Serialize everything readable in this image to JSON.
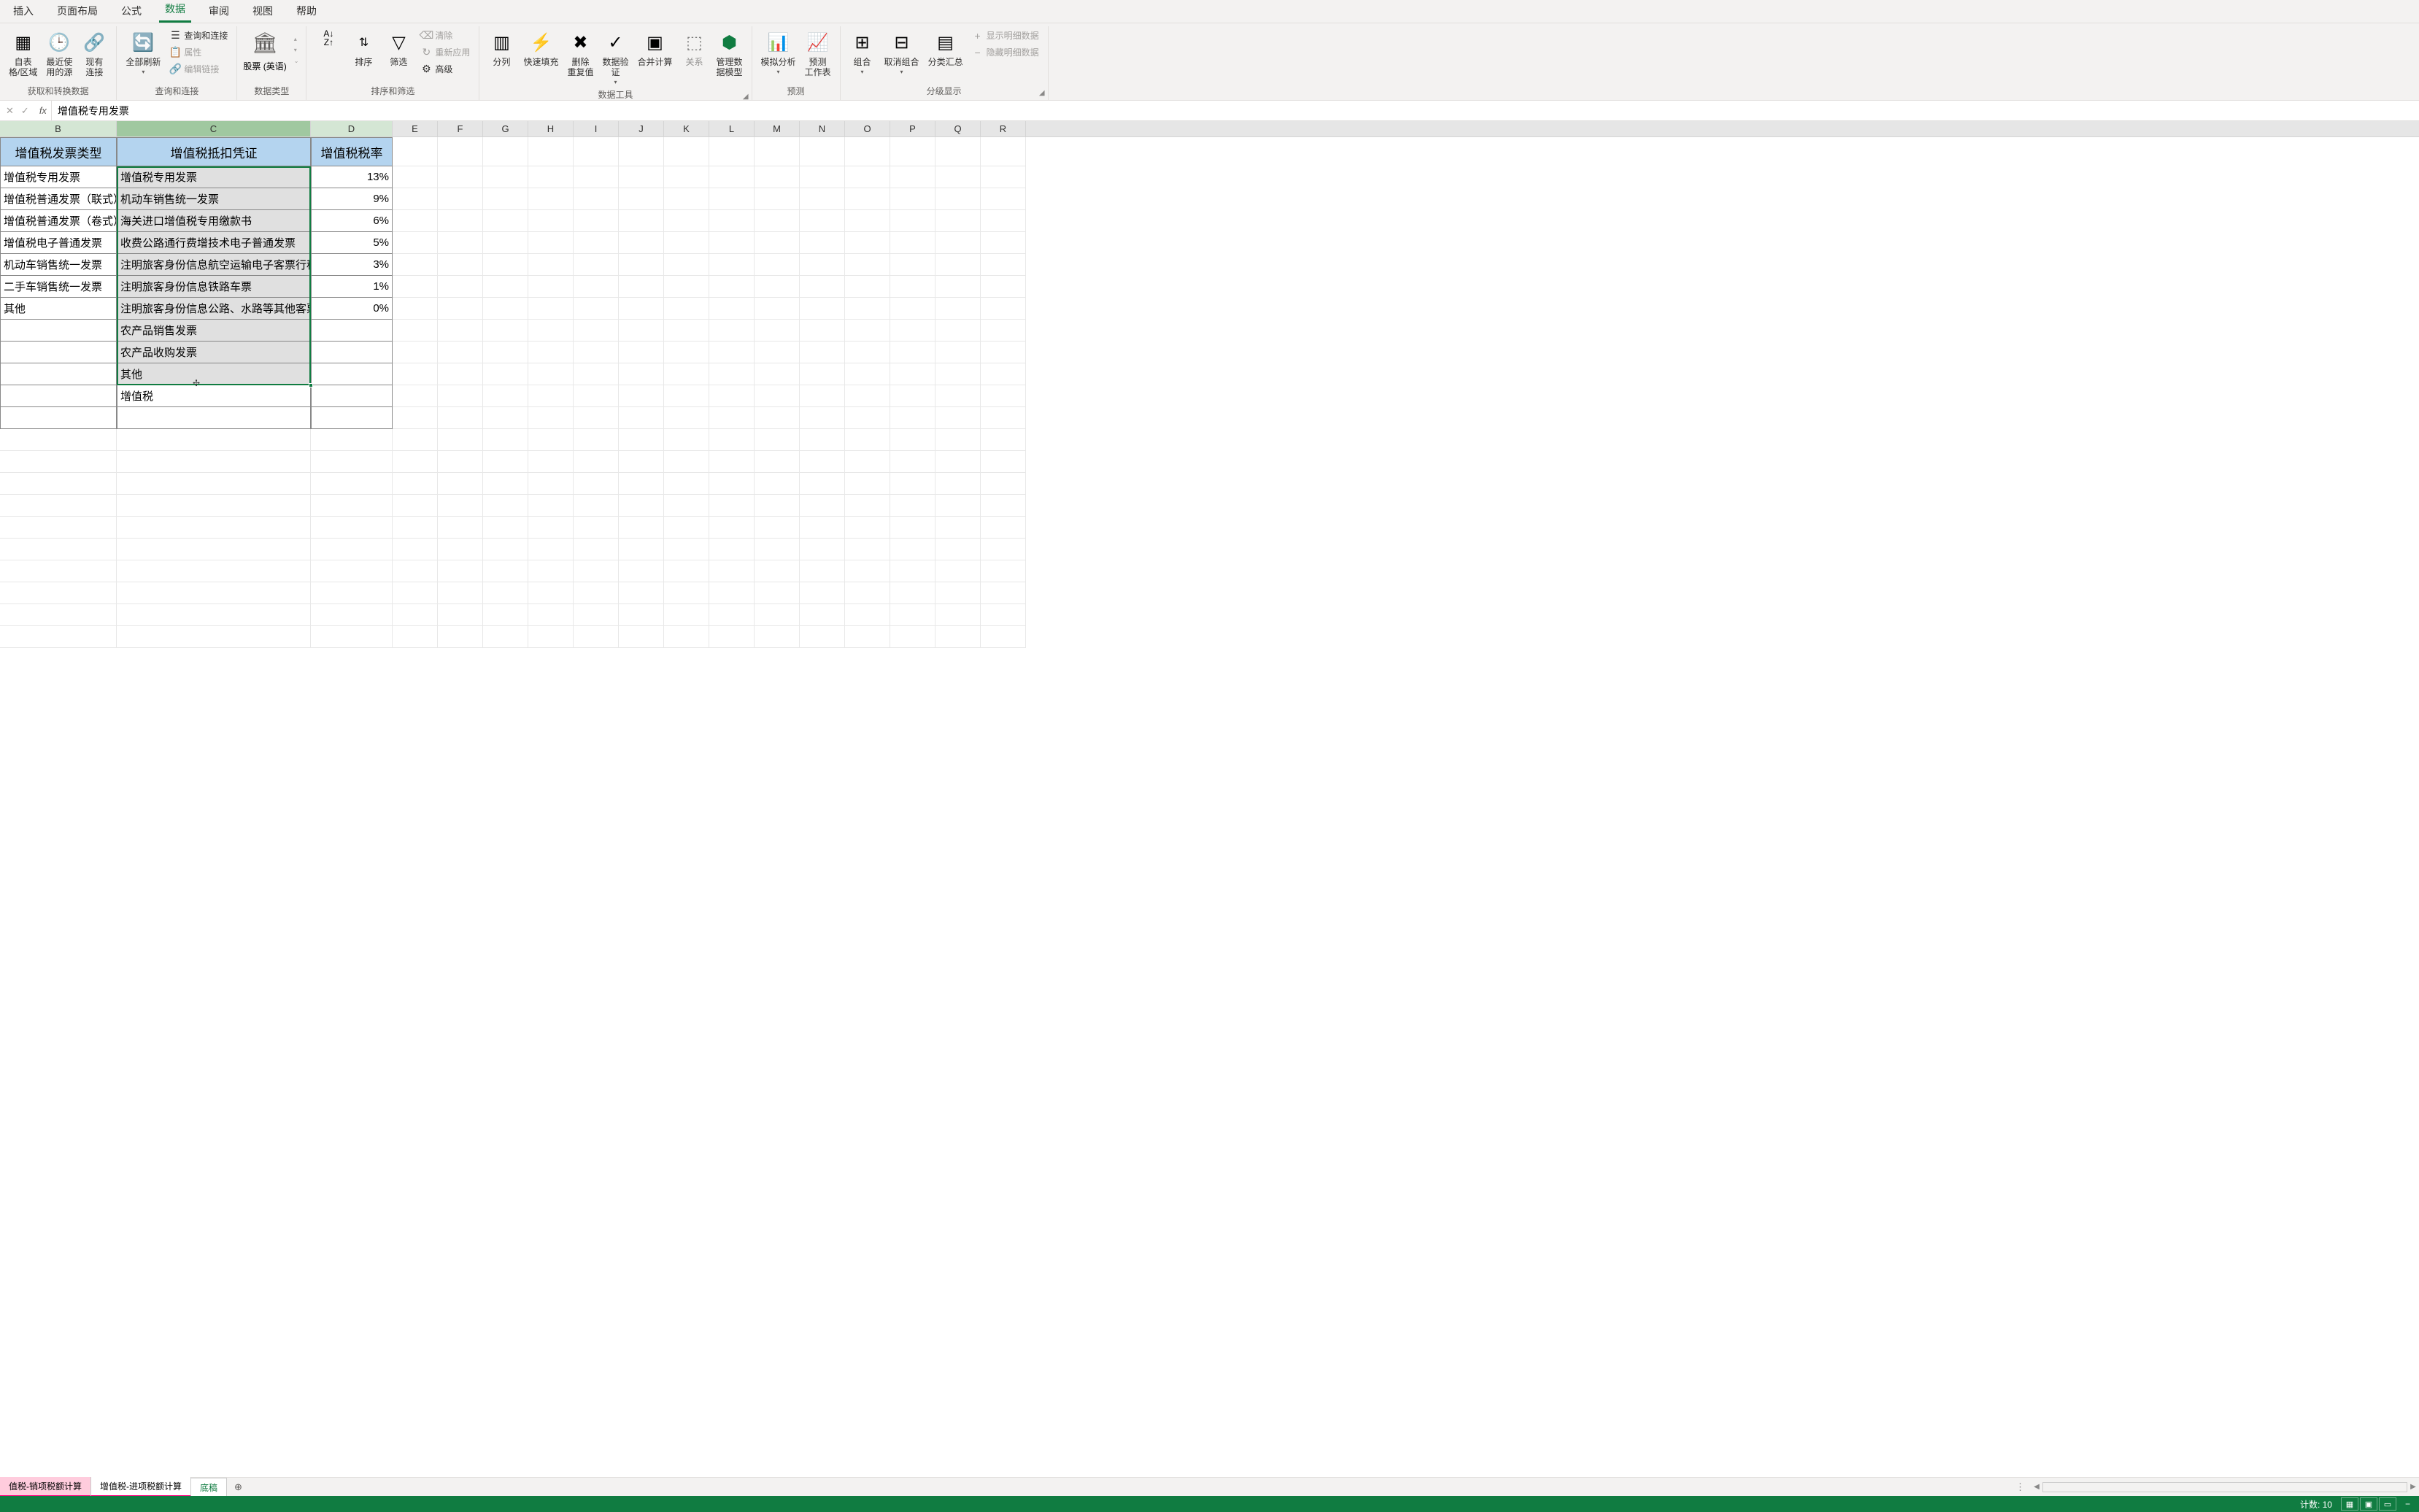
{
  "ribbon_tabs": [
    "插入",
    "页面布局",
    "公式",
    "数据",
    "审阅",
    "视图",
    "帮助"
  ],
  "active_tab_index": 3,
  "ribbon": {
    "get_data": {
      "from_table": "自表\n格/区域",
      "recent": "最近使\n用的源",
      "existing": "现有\n连接",
      "group_label": "获取和转换数据"
    },
    "queries": {
      "refresh_all": "全部刷新",
      "queries_conn": "查询和连接",
      "properties": "属性",
      "edit_links": "编辑链接",
      "group_label": "查询和连接"
    },
    "data_types": {
      "stocks": "股票 (英语)",
      "group_label": "数据类型"
    },
    "sort_filter": {
      "sort": "排序",
      "filter": "筛选",
      "clear": "清除",
      "reapply": "重新应用",
      "advanced": "高级",
      "group_label": "排序和筛选"
    },
    "data_tools": {
      "text_to_cols": "分列",
      "flash_fill": "快速填充",
      "remove_dup": "删除\n重复值",
      "data_valid": "数据验\n证",
      "consolidate": "合并计算",
      "relations": "关系",
      "data_model": "管理数\n据模型",
      "group_label": "数据工具"
    },
    "forecast": {
      "whatif": "模拟分析",
      "forecast_sheet": "预测\n工作表",
      "group_label": "预测"
    },
    "outline": {
      "group": "组合",
      "ungroup": "取消组合",
      "subtotal": "分类汇总",
      "show_detail": "显示明细数据",
      "hide_detail": "隐藏明细数据",
      "group_label": "分级显示"
    }
  },
  "formula_bar": {
    "value": "增值税专用发票"
  },
  "columns": [
    "B",
    "C",
    "D",
    "E",
    "F",
    "G",
    "H",
    "I",
    "J",
    "K",
    "L",
    "M",
    "N",
    "O",
    "P",
    "Q",
    "R"
  ],
  "table": {
    "headers": {
      "b": "增值税发票类型",
      "c": "增值税抵扣凭证",
      "d": "增值税税率"
    },
    "rows": [
      {
        "b": "增值税专用发票",
        "c": "增值税专用发票",
        "d": "13%"
      },
      {
        "b": "增值税普通发票（联式）",
        "c": "机动车销售统一发票",
        "d": "9%"
      },
      {
        "b": "增值税普通发票（卷式）",
        "c": "海关进口增值税专用缴款书",
        "d": "6%"
      },
      {
        "b": "增值税电子普通发票",
        "c": "收费公路通行费增技术电子普通发票",
        "d": "5%"
      },
      {
        "b": "机动车销售统一发票",
        "c": "注明旅客身份信息航空运输电子客票行程",
        "d": "3%"
      },
      {
        "b": "二手车销售统一发票",
        "c": "注明旅客身份信息铁路车票",
        "d": "1%"
      },
      {
        "b": "其他",
        "c": "注明旅客身份信息公路、水路等其他客票",
        "d": "0%"
      },
      {
        "b": "",
        "c": "农产品销售发票",
        "d": ""
      },
      {
        "b": "",
        "c": "农产品收购发票",
        "d": ""
      },
      {
        "b": "",
        "c": "其他",
        "d": ""
      },
      {
        "b": "",
        "c": "增值税",
        "d": ""
      },
      {
        "b": "",
        "c": "",
        "d": ""
      }
    ]
  },
  "sheets": [
    "值税-销项税额计算",
    "增值税-进项税额计算",
    "底稿"
  ],
  "status": {
    "count_label": "计数: 10"
  }
}
